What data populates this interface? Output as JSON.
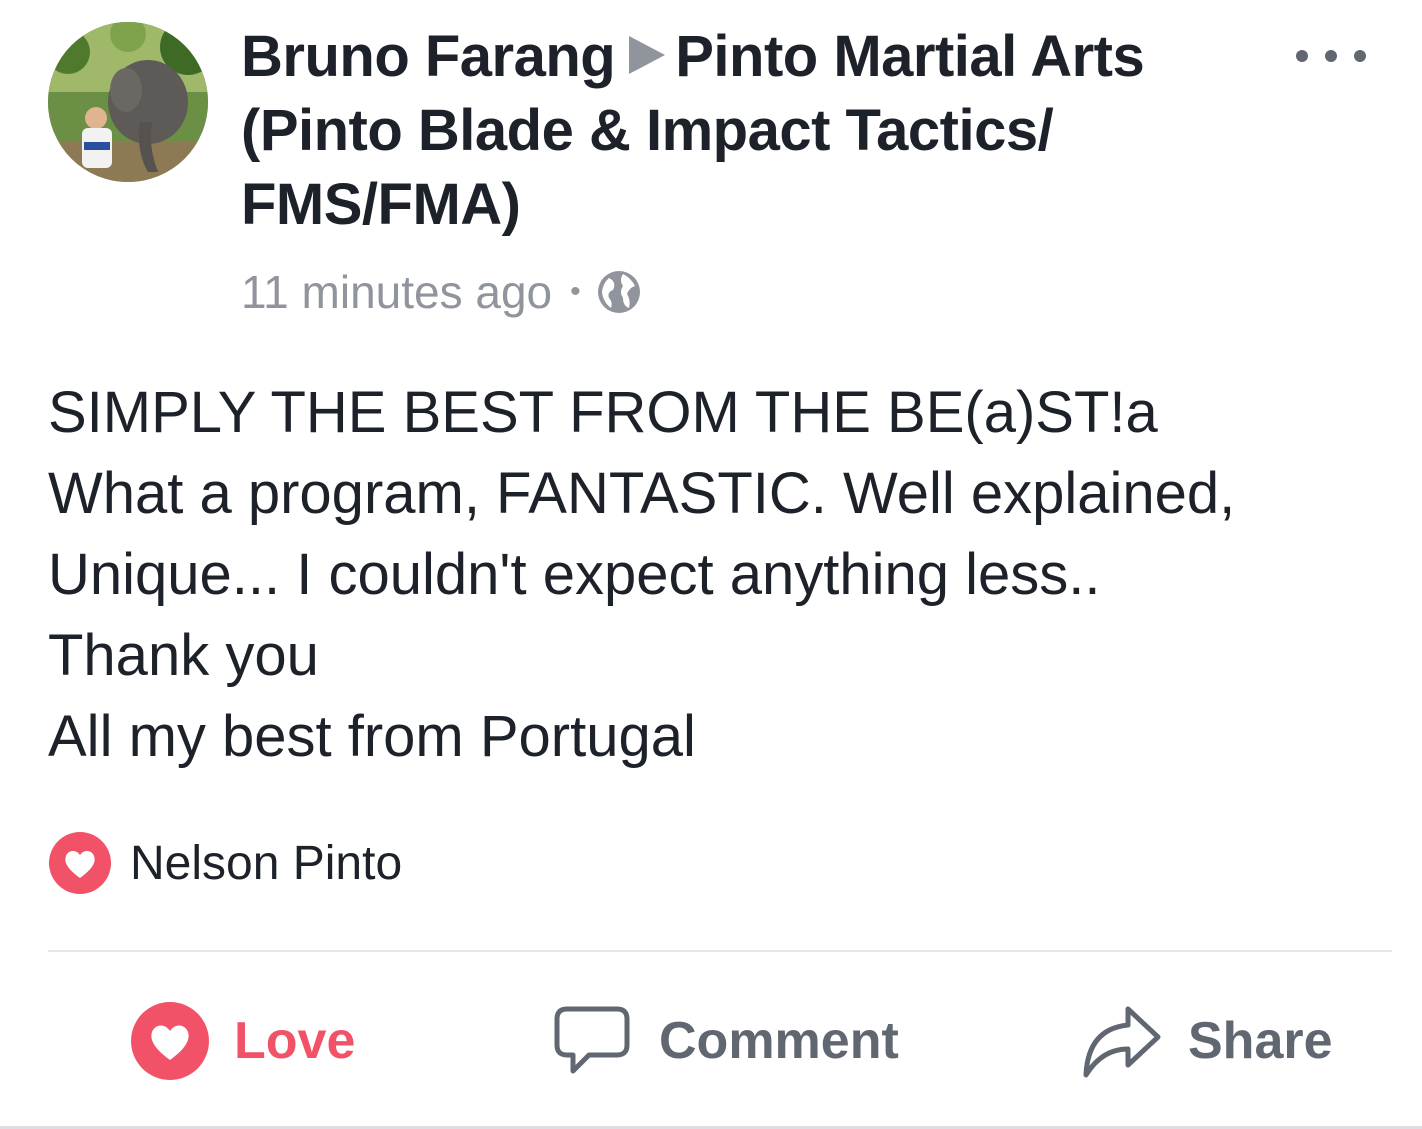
{
  "post": {
    "author": "Bruno Farang",
    "target_page_line1": "Pinto Martial Arts",
    "target_page_line2": "(Pinto Blade & Impact Tactics/",
    "target_page_line3": "FMS/FMA)",
    "timestamp": "11 minutes ago",
    "separator": "•",
    "privacy_icon": "globe-icon",
    "avatar_icon": "avatar-photo",
    "more_icon": "more-options-icon",
    "body_lines": [
      "SIMPLY THE BEST FROM THE BE(a)ST!a",
      "What a program, FANTASTIC. Well explained,",
      "Unique... I couldn't expect anything less..",
      "Thank you",
      "All my best from Portugal"
    ]
  },
  "reactions": {
    "icon": "heart-icon",
    "names": "Nelson Pinto"
  },
  "actions": {
    "love_label": "Love",
    "comment_label": "Comment",
    "share_label": "Share"
  },
  "colors": {
    "love_red": "#f25268",
    "text_dark": "#1d2129",
    "text_gray": "#606770",
    "meta_gray": "#90949c"
  }
}
